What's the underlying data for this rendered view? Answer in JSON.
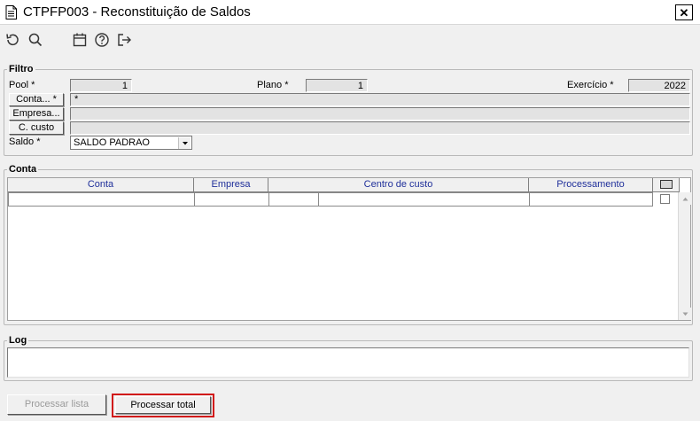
{
  "window": {
    "title": "CTPFP003 - Reconstituição de Saldos",
    "close_glyph": "✕"
  },
  "toolbar": {
    "icons": [
      "undo-icon",
      "search-icon",
      "calendar-icon",
      "help-icon",
      "exit-icon"
    ]
  },
  "filtro": {
    "label": "Filtro",
    "pool_label": "Pool *",
    "pool_value": "1",
    "plano_label": "Plano *",
    "plano_value": "1",
    "exercicio_label": "Exercício *",
    "exercicio_value": "2022",
    "conta_button": "Conta... *",
    "conta_value": "*",
    "empresa_button": "Empresa...",
    "empresa_value": "",
    "ccusto_button": "C. custo",
    "ccusto_value": "",
    "saldo_label": "Saldo *",
    "saldo_value": "SALDO PADRAO"
  },
  "conta_grid": {
    "label": "Conta",
    "columns": [
      "Conta",
      "Empresa",
      "Centro de custo",
      "Processamento"
    ],
    "rows": [
      {
        "conta": "",
        "empresa": "",
        "centro_custo_a": "",
        "centro_custo_b": "",
        "processamento": "",
        "checked": false
      }
    ]
  },
  "log": {
    "label": "Log",
    "value": ""
  },
  "actions": {
    "processar_lista": "Processar lista",
    "processar_total": "Processar total"
  },
  "colors": {
    "header_text": "#1f2f9a",
    "highlight": "#d11a1a"
  }
}
